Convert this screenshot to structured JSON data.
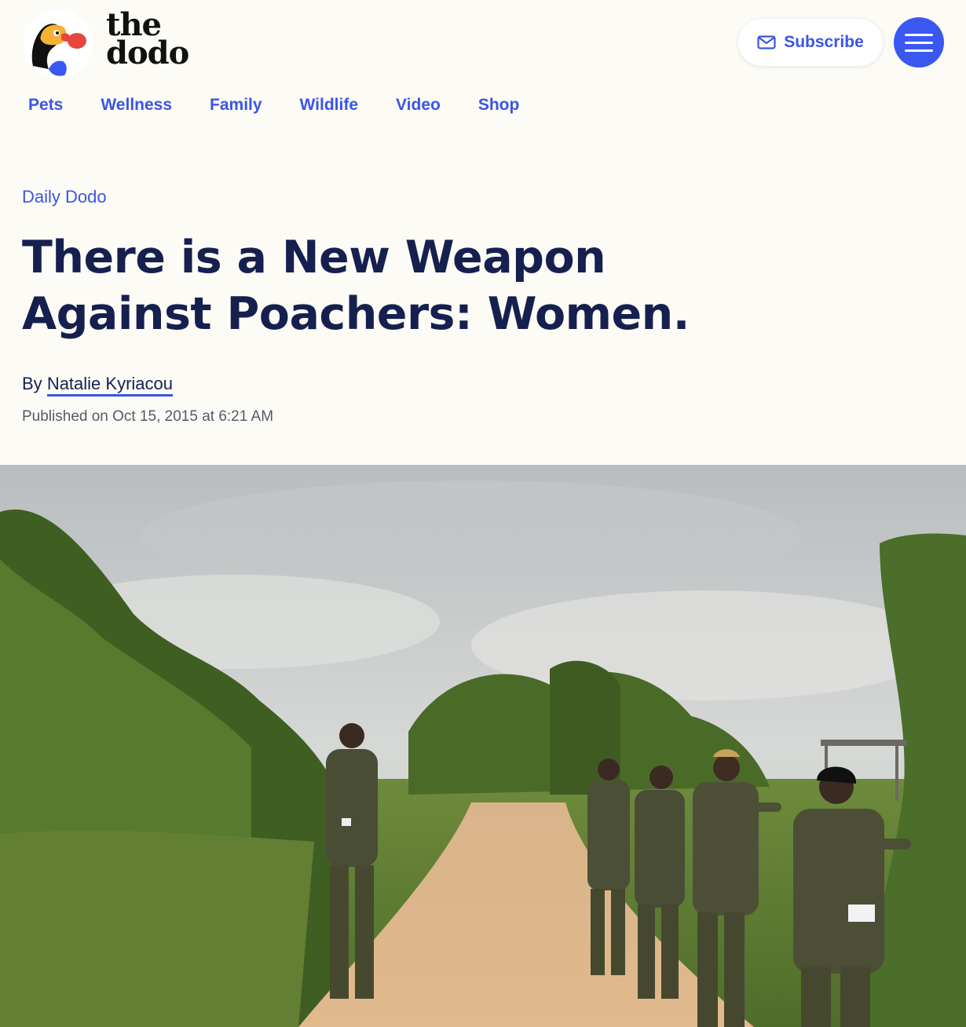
{
  "site": {
    "logo_line1": "the",
    "logo_line2": "dodo",
    "subscribe_label": "Subscribe",
    "brand_color": "#3a58f0"
  },
  "nav": {
    "items": [
      {
        "label": "Pets"
      },
      {
        "label": "Wellness"
      },
      {
        "label": "Family"
      },
      {
        "label": "Wildlife"
      },
      {
        "label": "Video"
      },
      {
        "label": "Shop"
      }
    ]
  },
  "article": {
    "kicker": "Daily Dodo",
    "headline": "There is a New Weapon Against Poachers: Women.",
    "by_prefix": "By",
    "author": "Natalie Kyriacou",
    "published": "Published on Oct 15, 2015 at 6:21 AM"
  },
  "icons": {
    "subscribe": "mail-icon",
    "menu": "hamburger-menu-icon"
  }
}
